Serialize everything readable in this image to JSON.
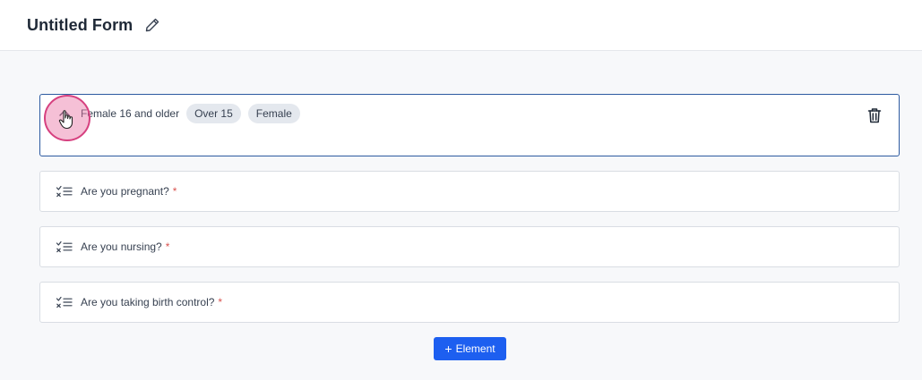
{
  "header": {
    "title": "Untitled Form",
    "edit_icon": "pencil-icon"
  },
  "condition": {
    "label": "Female 16 and older",
    "tags": [
      "Over 15",
      "Female"
    ],
    "toggle_icon": "chevron-up-icon",
    "delete_icon": "trash-icon"
  },
  "questions": [
    {
      "label": "Are you pregnant?",
      "required_mark": "*",
      "icon": "checklist-icon"
    },
    {
      "label": "Are you nursing?",
      "required_mark": "*",
      "icon": "checklist-icon"
    },
    {
      "label": "Are you taking birth control?",
      "required_mark": "*",
      "icon": "checklist-icon"
    }
  ],
  "add_button": {
    "icon": "+",
    "label": "Element"
  },
  "colors": {
    "accent": "#1d5ff0",
    "selected_border": "#2c5aa0",
    "required": "#d9534f",
    "tag_bg": "#e4e8ee",
    "cursor_highlight": "#e974a3"
  }
}
